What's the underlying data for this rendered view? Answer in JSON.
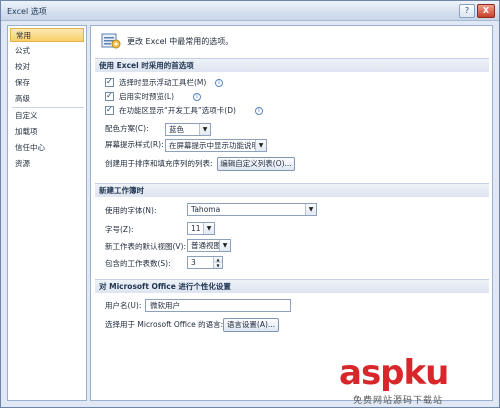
{
  "window": {
    "title": "Excel 选项",
    "help_label": "?",
    "close_label": "X"
  },
  "nav": {
    "items": [
      {
        "label": "常用",
        "active": true
      },
      {
        "label": "公式"
      },
      {
        "label": "校对"
      },
      {
        "label": "保存"
      },
      {
        "label": "高级"
      },
      {
        "label": "自定义"
      },
      {
        "label": "加载项"
      },
      {
        "label": "信任中心"
      },
      {
        "label": "资源"
      }
    ]
  },
  "banner": {
    "text": "更改 Excel 中最常用的选项。",
    "icon": "options-settings-icon"
  },
  "sections": {
    "top": {
      "title": "使用 Excel 时采用的首选项",
      "options": [
        {
          "label": "选择时显示浮动工具栏(M)",
          "checked": true,
          "has_info": true
        },
        {
          "label": "启用实时预览(L)",
          "checked": true,
          "has_info": true
        },
        {
          "label": "在功能区显示“开发工具”选项卡(D)",
          "checked": true,
          "has_info": true
        }
      ],
      "color_scheme_label": "配色方案(C):",
      "color_scheme_value": "蓝色",
      "screentip_label": "屏幕提示样式(R):",
      "screentip_value": "在屏幕提示中显示功能说明",
      "custom_list_label": "创建用于排序和填充序列的列表:",
      "custom_list_button": "编辑自定义列表(O)..."
    },
    "new_workbook": {
      "title": "新建工作簿时",
      "font_label": "使用的字体(N):",
      "font_value": "Tahoma",
      "size_label": "字号(Z):",
      "size_value": "11",
      "view_label": "新工作表的默认视图(V):",
      "view_value": "普通视图",
      "sheets_label": "包含的工作表数(S):",
      "sheets_value": "3"
    },
    "personalize": {
      "title": "对 Microsoft Office 进行个性化设置",
      "username_label": "用户名(U):",
      "username_value": "微软用户",
      "language_label": "选择用于 Microsoft Office 的语言:",
      "language_button": "语言设置(A)..."
    }
  },
  "watermark": {
    "main": "aspku",
    "sub": "免费网站源码下载站"
  }
}
